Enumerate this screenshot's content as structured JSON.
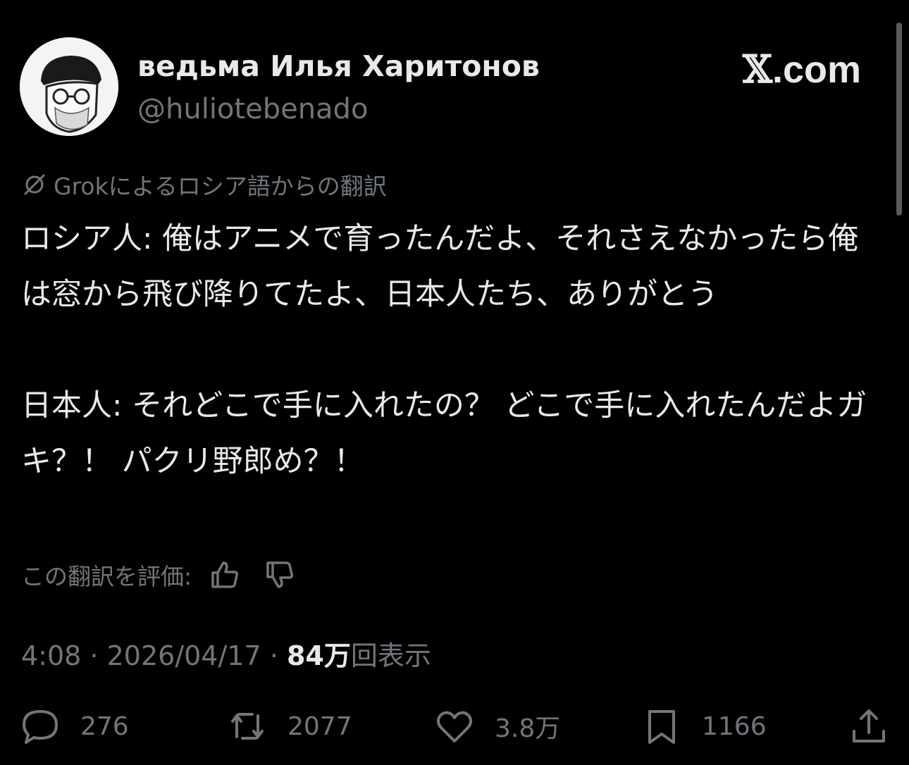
{
  "author": {
    "display_name": "ведьма Илья Харитонов",
    "handle": "@huliotebenado"
  },
  "brand": {
    "x": "𝕏",
    "domain": ".com"
  },
  "translation": {
    "note": "Grokによるロシア語からの翻訳"
  },
  "tweet": {
    "paragraph1": "ロシア人: 俺はアニメで育ったんだよ、それさえなかったら俺は窓から飛び降りてたよ、日本人たち、ありがとう",
    "paragraph2": "日本人: それどこで手に入れたの？ どこで手に入れたんだよガキ？！ パクリ野郎め？！"
  },
  "rate_translation": {
    "label": "この翻訳を評価:"
  },
  "meta": {
    "time": "4:08",
    "separator": "·",
    "date": "2026/04/17",
    "views_count": "84万",
    "views_label": "回表示"
  },
  "actions": {
    "reply_count": "276",
    "repost_count": "2077",
    "like_count": "3.8万",
    "bookmark_count": "1166"
  },
  "icons": [
    "translate-icon",
    "thumbs-up-icon",
    "thumbs-down-icon",
    "reply-icon",
    "repost-icon",
    "like-icon",
    "bookmark-icon",
    "share-icon"
  ]
}
